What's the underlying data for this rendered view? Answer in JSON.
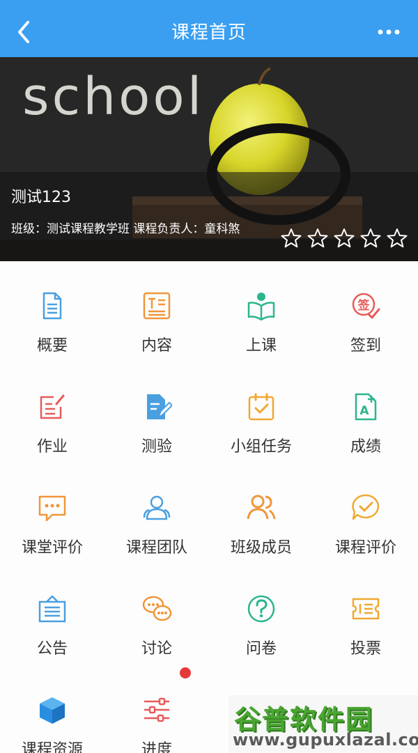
{
  "header": {
    "title": "课程首页"
  },
  "banner": {
    "chalk_text": "school",
    "course_name": "测试123",
    "course_info": "班级：测试课程教学班 课程负责人：童科煞",
    "rating": {
      "value": 0,
      "max": 5
    }
  },
  "menu": [
    {
      "label": "概要",
      "icon": "summary-doc-icon",
      "color": "#4a9fe0"
    },
    {
      "label": "内容",
      "icon": "content-list-icon",
      "color": "#f0963a"
    },
    {
      "label": "上课",
      "icon": "class-reader-icon",
      "color": "#2bb58f"
    },
    {
      "label": "签到",
      "icon": "checkin-stamp-icon",
      "color": "#e85a5a"
    },
    {
      "label": "作业",
      "icon": "homework-edit-icon",
      "color": "#e85a5a"
    },
    {
      "label": "测验",
      "icon": "quiz-pen-icon",
      "color": "#4a9fe0"
    },
    {
      "label": "小组任务",
      "icon": "group-task-calendar-icon",
      "color": "#f0a830"
    },
    {
      "label": "成绩",
      "icon": "grade-a-plus-icon",
      "color": "#2bb58f"
    },
    {
      "label": "课堂评价",
      "icon": "class-comment-icon",
      "color": "#f0963a"
    },
    {
      "label": "课程团队",
      "icon": "team-people-icon",
      "color": "#4a9fe0"
    },
    {
      "label": "班级成员",
      "icon": "members-icon",
      "color": "#f0963a"
    },
    {
      "label": "课程评价",
      "icon": "course-review-check-icon",
      "color": "#f0a830"
    },
    {
      "label": "公告",
      "icon": "announcement-icon",
      "color": "#4a9fe0"
    },
    {
      "label": "讨论",
      "icon": "discussion-chat-icon",
      "color": "#f0963a"
    },
    {
      "label": "问卷",
      "icon": "survey-question-icon",
      "color": "#2bb58f"
    },
    {
      "label": "投票",
      "icon": "vote-ticket-icon",
      "color": "#f0a830"
    },
    {
      "label": "课程资源",
      "icon": "resource-cube-icon",
      "color": "#2a8ee0"
    },
    {
      "label": "进度",
      "icon": "progress-sliders-icon",
      "color": "#e85a5a",
      "badge": true
    }
  ],
  "watermark": {
    "logo": "谷普软件园",
    "url": "www.gupuxlazal.com"
  }
}
